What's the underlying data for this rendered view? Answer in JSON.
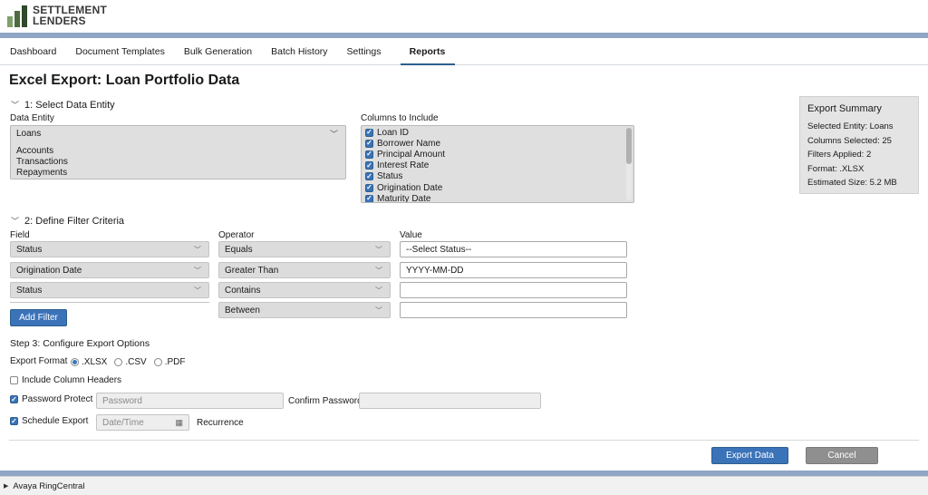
{
  "header": {
    "logo_line1": "SETTLEMENT",
    "logo_line2": "LENDERS"
  },
  "nav": {
    "items": [
      "Dashboard",
      "Document Templates",
      "Bulk Generation",
      "Batch History",
      "Settings",
      "Reports"
    ],
    "active": "Reports"
  },
  "page_title": "Excel Export: Loan Portfolio Data",
  "step1": {
    "heading": "1: Select Data Entity",
    "entity_label": "Data Entity",
    "entity_selected": "Loans",
    "entity_options": [
      "Accounts",
      "Transactions",
      "Repayments"
    ],
    "columns_label": "Columns to Include",
    "columns": [
      {
        "label": "Loan ID",
        "checked": true
      },
      {
        "label": "Borrower Name",
        "checked": true
      },
      {
        "label": "Principal Amount",
        "checked": true
      },
      {
        "label": "Interest Rate",
        "checked": true
      },
      {
        "label": "Status",
        "checked": true
      },
      {
        "label": "Origination Date",
        "checked": true
      },
      {
        "label": "Maturity Date",
        "checked": true
      }
    ]
  },
  "summary": {
    "title": "Export Summary",
    "rows": [
      "Selected Entity: Loans",
      "Columns Selected: 25",
      "Filters Applied: 2",
      "Format: .XLSX",
      "Estimated Size: 5.2 MB"
    ]
  },
  "step2": {
    "heading": "2: Define Filter Criteria",
    "field_label": "Field",
    "operator_label": "Operator",
    "value_label": "Value",
    "rows": [
      {
        "field": "Status",
        "operator": "Equals",
        "value": "--Select Status--"
      },
      {
        "field": "Origination Date",
        "operator": "Greater Than",
        "value": "YYYY-MM-DD"
      },
      {
        "field": "Status",
        "operator": "Contains",
        "value": ""
      },
      {
        "field": "",
        "operator": "Between",
        "value": ""
      }
    ],
    "add_filter": "Add Filter"
  },
  "step3": {
    "heading": "Step 3: Configure Export Options",
    "format_label": "Export Format",
    "formats": [
      ".XLSX",
      ".CSV",
      ".PDF"
    ],
    "format_selected": ".XLSX",
    "include_headers": "Include Column Headers",
    "include_headers_checked": false,
    "password_protect": "Password Protect",
    "password_protect_checked": true,
    "password_placeholder": "Password",
    "confirm_password": "Confirm Password",
    "schedule_export": "Schedule Export",
    "schedule_export_checked": true,
    "datetime_placeholder": "Date/Time",
    "recurrence": "Recurrence"
  },
  "actions": {
    "export": "Export Data",
    "cancel": "Cancel"
  },
  "status_bar": {
    "text": "Avaya RingCentral"
  },
  "colors": {
    "accent": "#3b73b9",
    "stripe": "#8fa6c4",
    "cancel": "#8f8f8f"
  }
}
